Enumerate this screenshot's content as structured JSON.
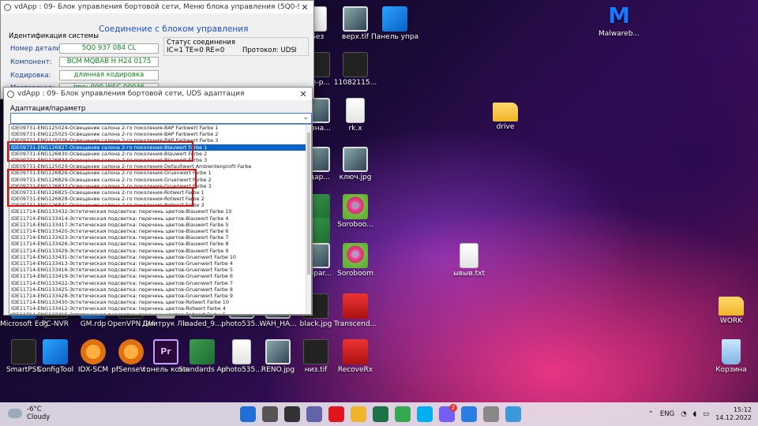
{
  "desktop": {
    "icons": [
      {
        "label": "Без",
        "kind": "file"
      },
      {
        "label": "верх.tif",
        "kind": "img"
      },
      {
        "label": "Панель управле...",
        "kind": "blue"
      },
      {
        "label": "Malwareb...",
        "kind": "mal"
      },
      {
        "label": "ree-p...",
        "kind": "dark"
      },
      {
        "label": "11082115...",
        "kind": "dark"
      },
      {
        "label": "я-зна...",
        "kind": "img"
      },
      {
        "label": "rk.x",
        "kind": "file"
      },
      {
        "label": "drive",
        "kind": "folder"
      },
      {
        "label": "ндар...",
        "kind": "img"
      },
      {
        "label": "ключ.jpg",
        "kind": "img"
      },
      {
        "label": "лиза...",
        "kind": "green"
      },
      {
        "label": "Soroboo...",
        "kind": "flower"
      },
      {
        "label": "кв.xlsx",
        "kind": "green"
      },
      {
        "label": "-clipar...",
        "kind": "img"
      },
      {
        "label": "Soroboom",
        "kind": "flower"
      },
      {
        "label": "ывыв.txt",
        "kind": "file"
      },
      {
        "label": "WORK",
        "kind": "folder"
      },
      {
        "label": "Microsoft Edge",
        "kind": "blue"
      },
      {
        "label": "PC-NVR",
        "kind": "dark"
      },
      {
        "label": "GM.rdp",
        "kind": "blue"
      },
      {
        "label": "OpenVPN GUI",
        "kind": "dark"
      },
      {
        "label": "Дмитрук Ліна Ана...",
        "kind": "file"
      },
      {
        "label": "loaded_9...",
        "kind": "img"
      },
      {
        "label": "photo535...",
        "kind": "img"
      },
      {
        "label": "WAH_HA...",
        "kind": "img"
      },
      {
        "label": "black.jpg",
        "kind": "dark"
      },
      {
        "label": "Transcend...",
        "kind": "red"
      },
      {
        "label": "SmartPSS",
        "kind": "dark"
      },
      {
        "label": "ConfigTool",
        "kind": "blue"
      },
      {
        "label": "IDX-SCM",
        "kind": "orange"
      },
      {
        "label": "pfSenseV...",
        "kind": "orange"
      },
      {
        "label": "тонель коханн...",
        "kind": "pr",
        "glyph": "Pr"
      },
      {
        "label": "Standards Audit 202...",
        "kind": "green"
      },
      {
        "label": "photo535...",
        "kind": "file"
      },
      {
        "label": "RENO.jpg",
        "kind": "img"
      },
      {
        "label": "низ.tif",
        "kind": "dark"
      },
      {
        "label": "RecoveRx",
        "kind": "red"
      },
      {
        "label": "Корзина",
        "kind": "bin"
      },
      {
        "label": "D",
        "kind": "blue"
      }
    ]
  },
  "window_main": {
    "title": "vdApp : 09- Блок управления бортовой сети,  Меню блока управления (5Q0-937-08X-HV1...",
    "heading": "Соединение с блоком управления",
    "system_id_label": "Идентификация системы",
    "fields": [
      {
        "label": "Номер детали:",
        "value": "5Q0 937 084 CL"
      },
      {
        "label": "Компонент:",
        "value": "BCM MQBAB H   H24 0175"
      },
      {
        "label": "Кодировка:",
        "value": "длинная кодировка"
      },
      {
        "label": "Мастерская:",
        "value": "Imp: 000     WSC 00046"
      }
    ],
    "status": {
      "label": "Статус соединения",
      "line": "IC=1  TE=0   RE=0",
      "protocol": "Протокол: UDS",
      "marker": "I"
    }
  },
  "window_adapt": {
    "title": "vdApp : 09- Блок управления бортовой сети,  UDS адаптация",
    "list_label": "Адаптация/параметр",
    "select_value": "",
    "items": [
      "IDE09731-ENG125024-Освещение салона 2-го поколения-BAP Farbwert Farbe 1",
      "IDE09731-ENG125025-Освещение салона 2-го поколения-BAP Farbwert Farbe 2",
      "IDE09731-ENG125026-Освещение салона 2-го поколения-BAP Farbwert Farbe 3",
      "IDE09731-ENG126827-Освещение салона 2-го поколения-Blauwert Farbe 1",
      "IDE09731-ENG126830-Освещение салона 2-го поколения-Blauwert Farbe 2",
      "IDE09731-ENG126833-Освещение салона 2-го поколения-Blauwert Farbe 3",
      "IDE09731-ENG125029-Освещение салона 2-го поколения-Defaultwert Ambientenprofil Farbe",
      "IDE09731-ENG126826-Освещение салона 2-го поколения-Gruenwert Farbe 1",
      "IDE09731-ENG126829-Освещение салона 2-го поколения-Gruenwert Farbe 2",
      "IDE09731-ENG126832-Освещение салона 2-го поколения-Gruenwert Farbe 3",
      "IDE09731-ENG126825-Освещение салона 2-го поколения-Rotwert Farbe 1",
      "IDE09731-ENG126828-Освещение салона 2-го поколения-Rotwert Farbe 2",
      "IDE09731-ENG126831-Освещение салона 2-го поколения-Rotwert Farbe 3",
      "IDE11714-ENG133432-Эстетическая подсветка: перечень цветов-Blauwert Farbe 10",
      "IDE11714-ENG133414-Эстетическая подсветка: перечень цветов-Blauwert Farbe 4",
      "IDE11714-ENG133417-Эстетическая подсветка: перечень цветов-Blauwert Farbe 5",
      "IDE11714-ENG133420-Эстетическая подсветка: перечень цветов-Blauwert Farbe 6",
      "IDE11714-ENG133423-Эстетическая подсветка: перечень цветов-Blauwert Farbe 7",
      "IDE11714-ENG133426-Эстетическая подсветка: перечень цветов-Blauwert Farbe 8",
      "IDE11714-ENG133429-Эстетическая подсветка: перечень цветов-Blauwert Farbe 9",
      "IDE11714-ENG133431-Эстетическая подсветка: перечень цветов-Gruenwert Farbe 10",
      "IDE11714-ENG133413-Эстетическая подсветка: перечень цветов-Gruenwert Farbe 4",
      "IDE11714-ENG133416-Эстетическая подсветка: перечень цветов-Gruenwert Farbe 5",
      "IDE11714-ENG133419-Эстетическая подсветка: перечень цветов-Gruenwert Farbe 6",
      "IDE11714-ENG133422-Эстетическая подсветка: перечень цветов-Gruenwert Farbe 7",
      "IDE11714-ENG133425-Эстетическая подсветка: перечень цветов-Gruenwert Farbe 8",
      "IDE11714-ENG133428-Эстетическая подсветка: перечень цветов-Gruenwert Farbe 9",
      "IDE11714-ENG133430-Эстетическая подсветка: перечень цветов-Rotwert Farbe 10",
      "IDE11714-ENG133412-Эстетическая подсветка: перечень цветов-Rotwert Farbe 4",
      "IDE11714-ENG133415-Эстетическая подсветка: перечень цветов-Rotwert Farbe 5"
    ],
    "selected_index": 3,
    "highlight_color": "#e01010"
  },
  "taskbar": {
    "weather_temp": "-6°C",
    "weather_text": "Cloudy",
    "apps": [
      {
        "name": "start",
        "color": "#1f6fd6"
      },
      {
        "name": "search",
        "color": "#555555"
      },
      {
        "name": "task-view",
        "color": "#333333"
      },
      {
        "name": "teams",
        "color": "#6264a7"
      },
      {
        "name": "opera",
        "color": "#e0161f"
      },
      {
        "name": "explorer",
        "color": "#f0b52a"
      },
      {
        "name": "excel",
        "color": "#1e7145"
      },
      {
        "name": "chrome",
        "color": "#34a853"
      },
      {
        "name": "skype",
        "color": "#00aff0"
      },
      {
        "name": "viber",
        "color": "#7360f2",
        "badge": "2"
      },
      {
        "name": "anydesk",
        "color": "#2a7de1"
      },
      {
        "name": "vdapp",
        "color": "#888888"
      },
      {
        "name": "other",
        "color": "#3a9ad9"
      }
    ],
    "language": "ENG",
    "time": "15:12",
    "date": "14.12.2022"
  }
}
